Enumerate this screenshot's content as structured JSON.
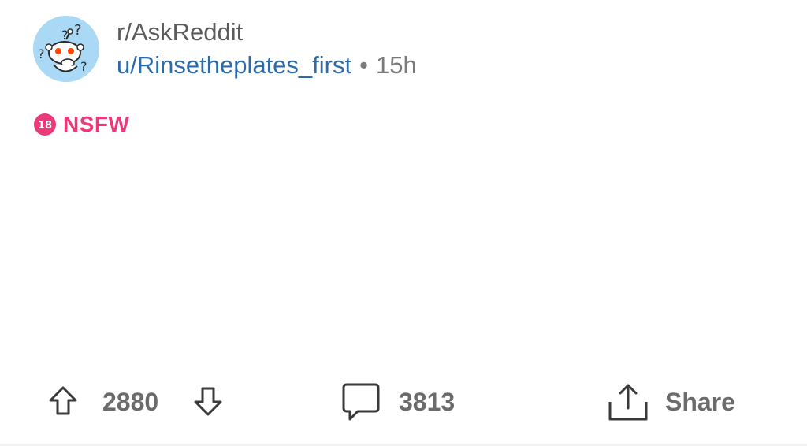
{
  "post": {
    "subreddit": "r/AskReddit",
    "author": "u/Rinsetheplates_first",
    "separator": "•",
    "age": "15h",
    "badge": {
      "number": "18",
      "label": "NSFW",
      "color": "#ea3a7a"
    }
  },
  "actions": {
    "score": "2880",
    "comments": "3813",
    "share_label": "Share"
  },
  "colors": {
    "link": "#2d6aaa",
    "muted": "#7a7a7a",
    "avatar_bg": "#a9d9f5"
  },
  "icons": {
    "avatar": "snoo-confused-avatar",
    "upvote": "upvote-arrow-icon",
    "downvote": "downvote-arrow-icon",
    "comment": "speech-bubble-icon",
    "share": "share-upload-icon"
  }
}
